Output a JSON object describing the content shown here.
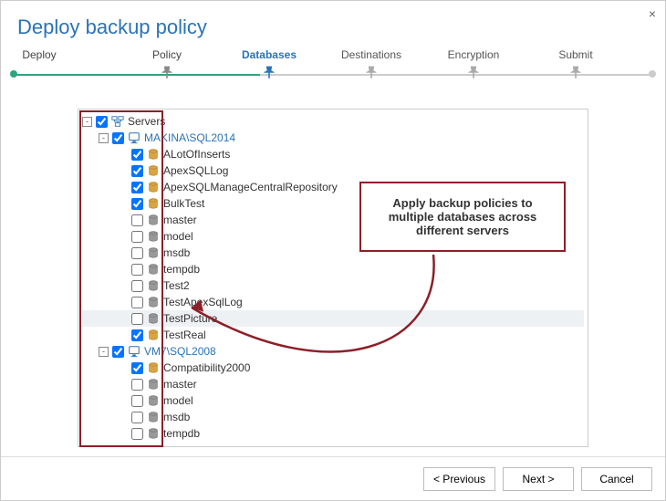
{
  "window": {
    "title": "Deploy backup policy",
    "close": "×"
  },
  "stepper": {
    "steps": [
      {
        "label": "Deploy",
        "pos": 4,
        "state": "done-start"
      },
      {
        "label": "Policy",
        "pos": 24,
        "state": "done"
      },
      {
        "label": "Databases",
        "pos": 40,
        "state": "active"
      },
      {
        "label": "Destinations",
        "pos": 56,
        "state": "pending"
      },
      {
        "label": "Encryption",
        "pos": 72,
        "state": "pending"
      },
      {
        "label": "Submit",
        "pos": 88,
        "state": "pending"
      }
    ]
  },
  "tree": {
    "root": {
      "label": "Servers",
      "checked": true,
      "expanded": true
    },
    "servers": [
      {
        "label": "MAKINA\\SQL2014",
        "checked": true,
        "expanded": true,
        "databases": [
          {
            "label": "ALotOfInserts",
            "checked": true
          },
          {
            "label": "ApexSQLLog",
            "checked": true
          },
          {
            "label": "ApexSQLManageCentralRepository",
            "checked": true
          },
          {
            "label": "BulkTest",
            "checked": true
          },
          {
            "label": "master",
            "checked": false
          },
          {
            "label": "model",
            "checked": false
          },
          {
            "label": "msdb",
            "checked": false
          },
          {
            "label": "tempdb",
            "checked": false
          },
          {
            "label": "Test2",
            "checked": false
          },
          {
            "label": "TestApexSqlLog",
            "checked": false
          },
          {
            "label": "TestPicture",
            "checked": false,
            "highlight": true
          },
          {
            "label": "TestReal",
            "checked": true
          }
        ]
      },
      {
        "label": "VM7\\SQL2008",
        "checked": true,
        "expanded": true,
        "databases": [
          {
            "label": "Compatibility2000",
            "checked": true
          },
          {
            "label": "master",
            "checked": false
          },
          {
            "label": "model",
            "checked": false
          },
          {
            "label": "msdb",
            "checked": false
          },
          {
            "label": "tempdb",
            "checked": false
          }
        ]
      }
    ]
  },
  "annotation": {
    "text": "Apply backup policies to multiple databases across different servers"
  },
  "footer": {
    "previous": "< Previous",
    "next": "Next >",
    "cancel": "Cancel"
  },
  "colors": {
    "accent": "#2a73b8",
    "annotation_border": "#8c1f28",
    "step_done": "#2fa37a"
  }
}
